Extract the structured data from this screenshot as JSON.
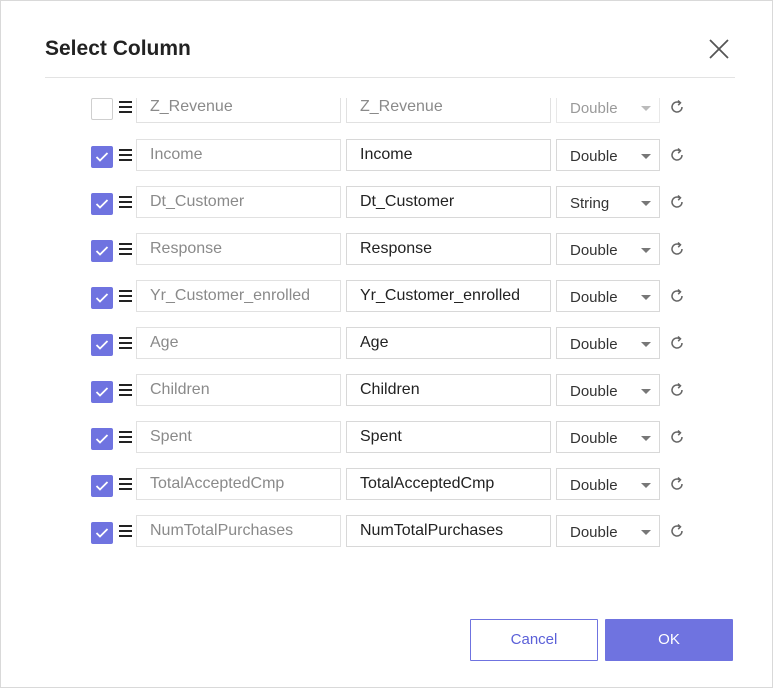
{
  "dialog": {
    "title": "Select Column",
    "cancel_label": "Cancel",
    "ok_label": "OK",
    "accent_color": "#6f73e0"
  },
  "rows": [
    {
      "checked": false,
      "original": "Z_Revenue",
      "name": "Z_Revenue",
      "type": "Double"
    },
    {
      "checked": true,
      "original": "Income",
      "name": "Income",
      "type": "Double"
    },
    {
      "checked": true,
      "original": "Dt_Customer",
      "name": "Dt_Customer",
      "type": "String"
    },
    {
      "checked": true,
      "original": "Response",
      "name": "Response",
      "type": "Double"
    },
    {
      "checked": true,
      "original": "Yr_Customer_enrolled",
      "name": "Yr_Customer_enrolled",
      "type": "Double"
    },
    {
      "checked": true,
      "original": "Age",
      "name": "Age",
      "type": "Double"
    },
    {
      "checked": true,
      "original": "Children",
      "name": "Children",
      "type": "Double"
    },
    {
      "checked": true,
      "original": "Spent",
      "name": "Spent",
      "type": "Double"
    },
    {
      "checked": true,
      "original": "TotalAcceptedCmp",
      "name": "TotalAcceptedCmp",
      "type": "Double"
    },
    {
      "checked": true,
      "original": "NumTotalPurchases",
      "name": "NumTotalPurchases",
      "type": "Double"
    }
  ]
}
